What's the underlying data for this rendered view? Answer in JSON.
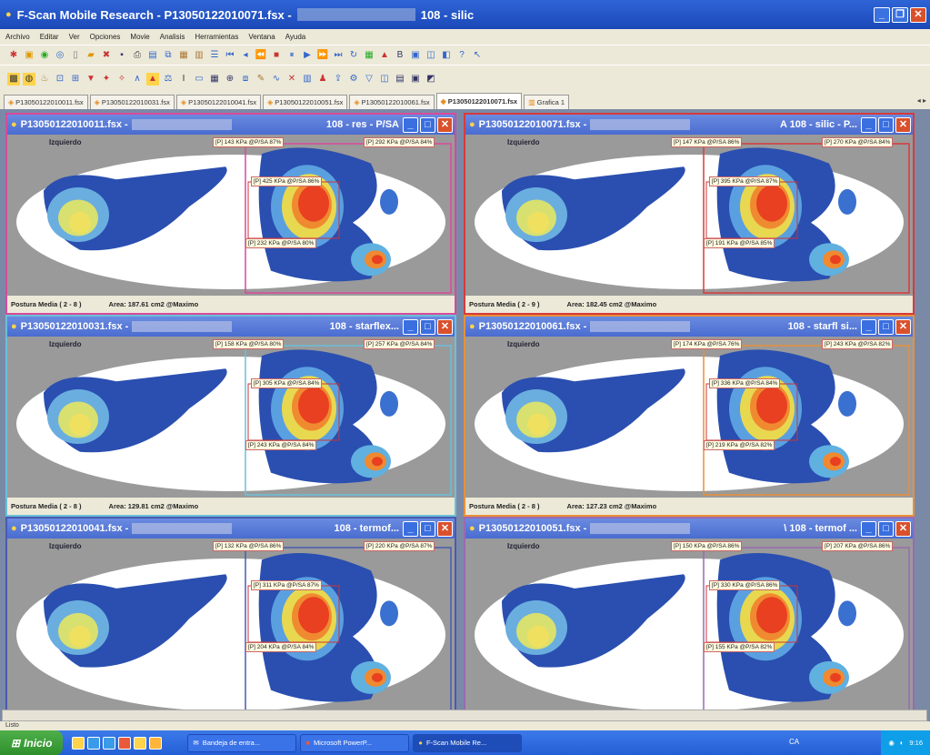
{
  "window": {
    "title": "F-Scan Mobile Research - P13050122010071.fsx -",
    "title_suffix": "108 - silic"
  },
  "menu": [
    "Archivo",
    "Editar",
    "Ver",
    "Opciones",
    "Movie",
    "Analisis",
    "Herramientas",
    "Ventana",
    "Ayuda"
  ],
  "tabs": [
    {
      "label": "P13050122010011.fsx",
      "active": false
    },
    {
      "label": "P13050122010031.fsx",
      "active": false
    },
    {
      "label": "P13050122010041.fsx",
      "active": false
    },
    {
      "label": "P13050122010051.fsx",
      "active": false
    },
    {
      "label": "P13050122010061.fsx",
      "active": false
    },
    {
      "label": "P13050122010071.fsx",
      "active": true
    },
    {
      "label": "Grafica 1",
      "active": false
    }
  ],
  "tab_scroll": "◂ ▸",
  "panels": [
    {
      "file": "P13050122010011.fsx -",
      "label": "108 - res - P/SA",
      "side": "Izquierdo",
      "a1": "[P] 143 KPa @P/SA 87%",
      "a2": "[P] 292 KPa @P/SA 84%",
      "a3": "[P] 425 KPa @P/SA 86%",
      "a4": "[P] 232 KPa @P/SA 80%",
      "foot1": "Postura Media ( 2 - 8 )",
      "foot2": "Area: 187.61 cm2 @Maximo",
      "border": "#d94a9a"
    },
    {
      "file": "P13050122010071.fsx -",
      "label": "A 108 - silic - P...",
      "side": "Izquierdo",
      "a1": "[P] 147 KPa @P/SA 86%",
      "a2": "[P] 270 KPa @P/SA 84%",
      "a3": "[P] 395 KPa @P/SA 87%",
      "a4": "[P] 191 KPa @P/SA 85%",
      "foot1": "Postura Media ( 2 - 9 )",
      "foot2": "Area: 182.45 cm2 @Maximo",
      "border": "#d93a3a"
    },
    {
      "file": "P13050122010031.fsx -",
      "label": "108 - starflex...",
      "side": "Izquierdo",
      "a1": "[P] 158 KPa @P/SA 80%",
      "a2": "[P] 257 KPa @P/SA 84%",
      "a3": "[P] 305 KPa @P/SA 84%",
      "a4": "[P] 243 KPa @P/SA 84%",
      "foot1": "Postura Media ( 2 - 8 )",
      "foot2": "Area: 129.81 cm2 @Maximo",
      "border": "#6ac0d9"
    },
    {
      "file": "P13050122010061.fsx -",
      "label": "108 - starfl si...",
      "side": "Izquierdo",
      "a1": "[P] 174 KPa @P/SA 76%",
      "a2": "[P] 243 KPa @P/SA 82%",
      "a3": "[P] 336 KPa @P/SA 84%",
      "a4": "[P] 219 KPa @P/SA 82%",
      "foot1": "Postura Media ( 2 - 8 )",
      "foot2": "Area: 127.23 cm2 @Maximo",
      "border": "#e8903a"
    },
    {
      "file": "P13050122010041.fsx -",
      "label": "108 - termof...",
      "side": "Izquierdo",
      "a1": "[P] 132 KPa @P/SA 86%",
      "a2": "[P] 220 KPa @P/SA 87%",
      "a3": "[P] 311 KPa @P/SA 87%",
      "a4": "[P] 204 KPa @P/SA 84%",
      "foot1": "",
      "foot2": "",
      "border": "#4a5ab0"
    },
    {
      "file": "P13050122010051.fsx -",
      "label": "\\ 108 - termof ...",
      "side": "Izquierdo",
      "a1": "[P] 150 KPa @P/SA 86%",
      "a2": "[P] 207 KPa @P/SA 86%",
      "a3": "[P] 330 KPa @P/SA 86%",
      "a4": "[P] 155 KPa @P/SA 82%",
      "foot1": "",
      "foot2": "",
      "border": "#9a6ab0"
    }
  ],
  "status": "Listo",
  "taskbar": {
    "start": "Inicio",
    "tasks": [
      {
        "label": "Bandeja de entra...",
        "active": false
      },
      {
        "label": "Microsoft PowerP...",
        "active": false
      },
      {
        "label": "F-Scan Mobile Re...",
        "active": true
      }
    ],
    "lang": "CA",
    "clock": "9:16"
  }
}
